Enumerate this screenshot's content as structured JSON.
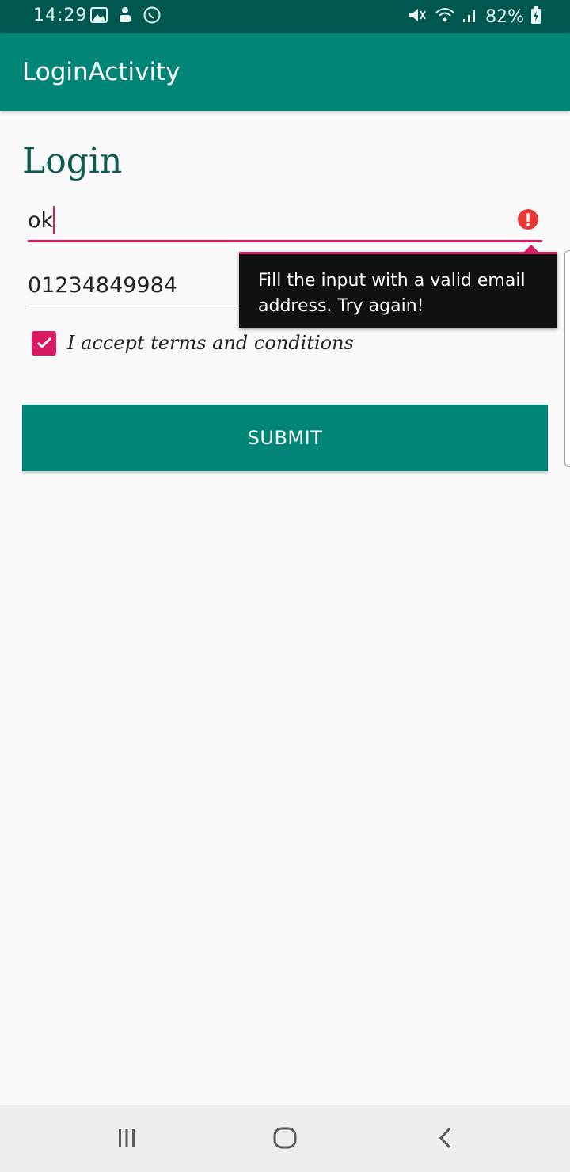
{
  "status_bar": {
    "time": "14:29",
    "battery": "82%",
    "icons": [
      "gallery-icon",
      "upload-icon",
      "whatsapp-icon",
      "mute-icon",
      "wifi-icon",
      "signal-icon",
      "battery-icon"
    ]
  },
  "app_bar": {
    "title": "LoginActivity"
  },
  "form": {
    "title": "Login",
    "email": {
      "value": "ok",
      "error": "Fill the input with a valid email address. Try again!"
    },
    "phone": {
      "value": "01234849984"
    },
    "terms": {
      "label": "I accept terms and conditions",
      "checked": true
    },
    "submit_label": "SUBMIT"
  },
  "nav_bar": {
    "icons": [
      "recents-icon",
      "home-icon",
      "back-icon"
    ]
  },
  "colors": {
    "primary": "#008577",
    "primary_dark": "#00574f",
    "accent": "#d81b60",
    "error": "#e53935"
  }
}
